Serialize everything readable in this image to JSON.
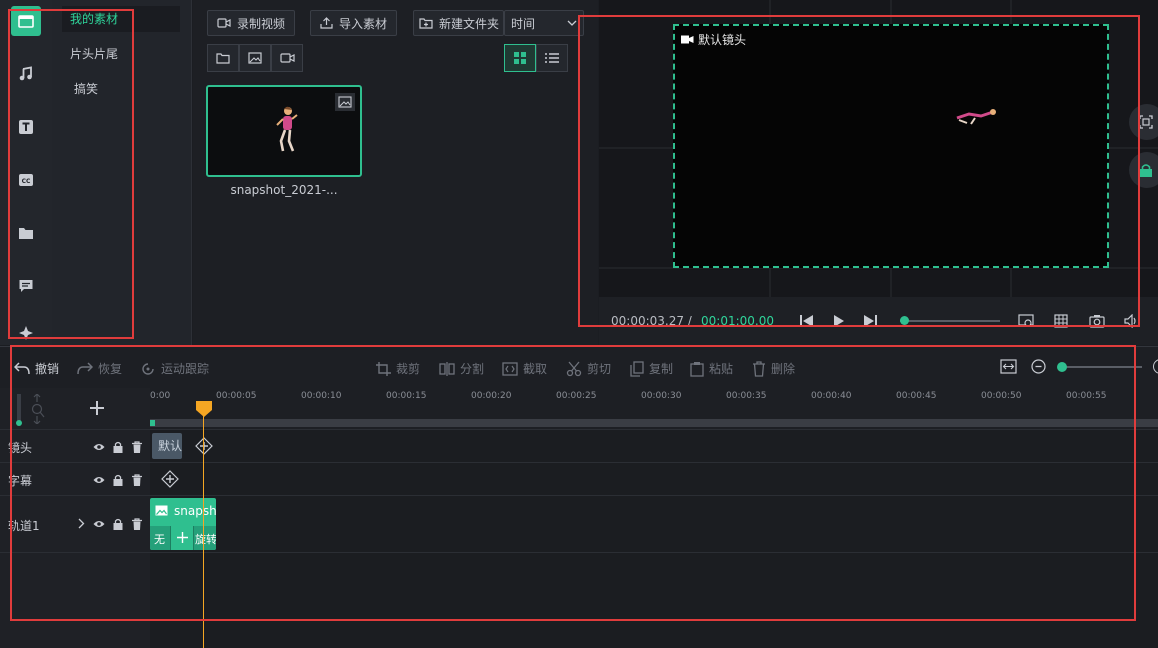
{
  "rail": {
    "icons": [
      "media-icon",
      "music-icon",
      "text-icon",
      "caption-icon",
      "folder-icon",
      "chat-icon",
      "effects-icon"
    ]
  },
  "categories": [
    "我的素材",
    "片头片尾",
    "搞笑"
  ],
  "library": {
    "record_label": "录制视频",
    "import_label": "导入素材",
    "new_folder_label": "新建文件夹",
    "sort_label": "时间",
    "clip_name": "snapshot_2021-..."
  },
  "preview": {
    "camera_label": "默认镜头",
    "current_time": "00:00:03.27 /",
    "total_time": "00:01:00.00"
  },
  "timeline": {
    "undo": "撤销",
    "redo": "恢复",
    "motion": "运动跟踪",
    "crop": "裁剪",
    "split": "分割",
    "cut_out": "截取",
    "cut": "剪切",
    "copy": "复制",
    "paste": "粘贴",
    "delete": "删除",
    "ticks": [
      "0:00",
      "00:00:05",
      "00:00:10",
      "00:00:15",
      "00:00:20",
      "00:00:25",
      "00:00:30",
      "00:00:35",
      "00:00:40",
      "00:00:45",
      "00:00:50",
      "00:00:55"
    ],
    "tracks": [
      "镜头",
      "字幕",
      "轨道1"
    ],
    "camera_clip": "默认",
    "media_clip": "snapshot",
    "clip_none": "无",
    "clip_rotate": "旋转"
  },
  "colors": {
    "accent": "#2fbf8f",
    "playhead": "#f5a623",
    "annotation": "#e03c3c"
  }
}
